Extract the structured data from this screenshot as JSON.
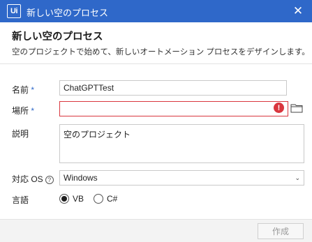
{
  "window": {
    "logo_text": "Ui",
    "title": "新しい空のプロセス",
    "close_glyph": "✕"
  },
  "header": {
    "heading": "新しい空のプロセス",
    "subtitle": "空のプロジェクトで始めて、新しいオートメーション プロセスをデザインします。"
  },
  "form": {
    "name": {
      "label": "名前",
      "required": "*",
      "value": "ChatGPTTest"
    },
    "location": {
      "label": "場所",
      "required": "*",
      "value": "",
      "error_glyph": "!",
      "browse_icon": "folder-icon"
    },
    "description": {
      "label": "説明",
      "value": "空のプロジェクト"
    },
    "target_os": {
      "label": "対応 OS",
      "help_glyph": "?",
      "value": "Windows",
      "chevron": "⌄"
    },
    "language": {
      "label": "言語",
      "options": [
        {
          "label": "VB",
          "selected": true
        },
        {
          "label": "C#",
          "selected": false
        }
      ]
    }
  },
  "footer": {
    "create_label": "作成"
  },
  "colors": {
    "titlebar": "#2f68c9",
    "accent": "#2f68c9",
    "error": "#d9363e"
  }
}
